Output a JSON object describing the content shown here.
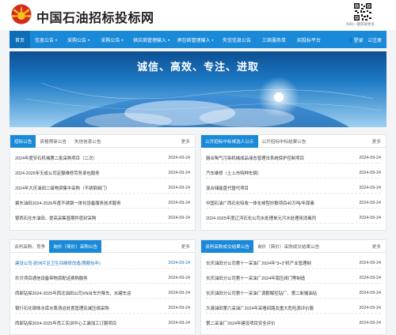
{
  "header": {
    "title": "中国石油招标投标网",
    "qr_caption": "扫码一键获取更多"
  },
  "nav": {
    "items": [
      {
        "label": "首页",
        "dropdown": false,
        "width": 26,
        "active": true
      },
      {
        "label": "信息公告",
        "dropdown": true,
        "width": 40
      },
      {
        "label": "采购公告",
        "dropdown": true,
        "width": 42
      },
      {
        "label": "采购公告",
        "dropdown": true,
        "width": 43
      },
      {
        "label": "供应商管理输入",
        "dropdown": true,
        "width": 56
      },
      {
        "label": "承包商管理输入",
        "dropdown": true,
        "width": 55
      },
      {
        "label": "失信信息公告",
        "dropdown": false,
        "width": 50
      },
      {
        "label": "三商服务单",
        "dropdown": false,
        "width": 44
      },
      {
        "label": "招投标平台",
        "dropdown": false,
        "width": 44
      }
    ],
    "login": "登录",
    "register": "注册"
  },
  "banner": {
    "slogan": "诚信、高效、专注、进取"
  },
  "colors": {
    "brand_blue": "#1a8ad8",
    "logo_red": "#d42a1e",
    "logo_yellow": "#f3c31b"
  },
  "panels": [
    {
      "tabs": [
        "招标公告",
        "资格预审公告",
        "失信信息公告"
      ],
      "more": "更多",
      "rows": [
        {
          "title": "2024年度安石机械第二批采购项目（二次）",
          "date": "2024-09-24"
        },
        {
          "title": "2024-2025年天成公司定额维修劳务承包服务",
          "date": "2024-09-24"
        },
        {
          "title": "2024年大庆油田二级物资集中采购（不锈钢阀门）",
          "date": "2024-09-24"
        },
        {
          "title": "冀东油田2024-2026年度不锈钢一体化设备服务技术服务",
          "date": "2024-09-24"
        },
        {
          "title": "银西石化东油田、提高采集篮期件密封采购",
          "date": "2024-09-24"
        }
      ]
    },
    {
      "tabs": [
        "公开招标中标候选人公示",
        "公开招标中标结果公告"
      ],
      "more": "更多",
      "rows": [
        {
          "title": "融合陶气污染机械成品液态管理法系统保护控制项目",
          "date": "2024-09-24"
        },
        {
          "title": "汽车维修（土上市特种车辆）",
          "date": "2024-09-24"
        },
        {
          "title": "混合储能盘代替代项目",
          "date": "2024-09-24"
        },
        {
          "title": "中国石油广西石化吸收一体化候型抄数项目40万吨/年尿素",
          "date": "2024-09-24"
        },
        {
          "title": "2024-2025年度辽河石化公司水处理单元污水处理用消毒剂",
          "date": "2024-09-24"
        }
      ]
    },
    {
      "tabs": [
        "谈判采购、竞争",
        "询价（简价）采购公告"
      ],
      "active_tab": 1,
      "more": "更多",
      "rows": [
        {
          "title": "建设公司-欧洲片区卫生间维修改造(限额包年)",
          "date": "2024-09-24",
          "highlight": true
        },
        {
          "title": "珍贝项目通信设备带物资配运费购服务",
          "date": "2024-09-24"
        },
        {
          "title": "西部钻探2024-2025年西北油田公司XN台车升降车、水罐车运",
          "date": "2024-09-24"
        },
        {
          "title": "银行石化钢体水库水泵清运处置管理及减压阀采购",
          "date": "2024-09-24"
        },
        {
          "title": "西部钻探2024-2025年员工实训中心工装加工订服项目",
          "date": "2024-09-24"
        }
      ]
    },
    {
      "tabs": [
        "谈判采购成交结果公告",
        "询价（简价）采购成交结果公告"
      ],
      "more": "更多",
      "rows": [
        {
          "title": "长庆油田分公司第十一采油厂2024年\"3+3\"机产业管理制",
          "date": "2024-09-24"
        },
        {
          "title": "长庆油田分公司第十一采油厂2024年南压阀门等制造",
          "date": "2024-09-24"
        },
        {
          "title": "长庆油田分公司第十一采油厂调郡解控钻厂、第二新输油站",
          "date": "2024-09-24"
        },
        {
          "title": "大港油田第六采油厂2024年采墙间路及重大危险源评价服",
          "date": "2024-09-24"
        },
        {
          "title": "第二采油厂2024年建设项目安全评价",
          "date": "2024-09-24"
        }
      ]
    }
  ]
}
